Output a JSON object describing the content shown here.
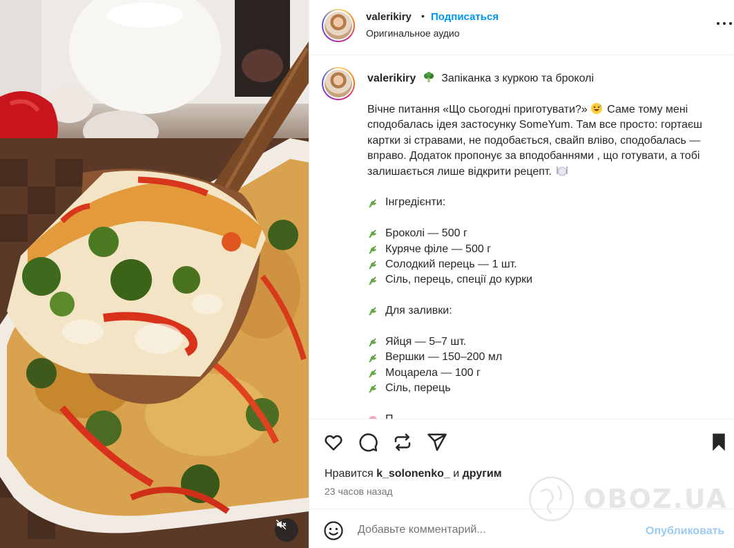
{
  "post": {
    "username": "valerikiry",
    "separator": "•",
    "follow_label": "Подписаться",
    "audio_label": "Оригинальное аудио"
  },
  "caption": {
    "username": "valerikiry",
    "title_emoji": "broccoli",
    "title": "Запіканка з куркою та броколі",
    "intro_part1": "Вічне питання «Що сьогодні приготувати?»",
    "intro_emoji": "grinning-sweat-face",
    "intro_part2": "Саме тому мені сподобалась ідея застосунку SomeYum. Там все просто: гортаєш картки зі стравами, не подобається, свайп вліво, сподобалась — вправо. Додаток пропонує за вподобаннями , що готувати, а тобі залишається лише відкрити рецепт.",
    "intro_end_emoji": "plate-with-cutlery",
    "line_emoji": "herb",
    "ingredients_heading": "Інгредієнти:",
    "ingredients": [
      "Броколі — 500 г",
      "Куряче філе — 500 г",
      "Солодкий перець — 1 шт.",
      "Сіль, перець, спеції до курки"
    ],
    "filling_heading": "Для заливки:",
    "filling": [
      "Яйця — 5–7 шт.",
      "Вершки — 150–200 мл",
      "Моцарела — 100 г",
      "Сіль, перець"
    ],
    "next_partial": "П"
  },
  "actions": {
    "icons": [
      "heart-icon",
      "comment-icon",
      "repost-icon",
      "share-icon",
      "bookmark-icon"
    ],
    "likes_prefix": "Нравится",
    "likes_user": "k_solonenko_",
    "likes_and": "и",
    "likes_others": "другим",
    "timestamp": "23 часов назад"
  },
  "comment": {
    "placeholder": "Добавьте комментарий...",
    "post_label": "Опубликовать"
  },
  "watermark": {
    "text": "OBOZ.UA"
  },
  "media": {
    "mute_icon": "speaker-muted-icon"
  },
  "colors": {
    "link_blue": "#0095f6",
    "post_disabled": "#9ccaf3",
    "text": "#262626",
    "secondary": "#737373",
    "divider": "#efefef"
  }
}
